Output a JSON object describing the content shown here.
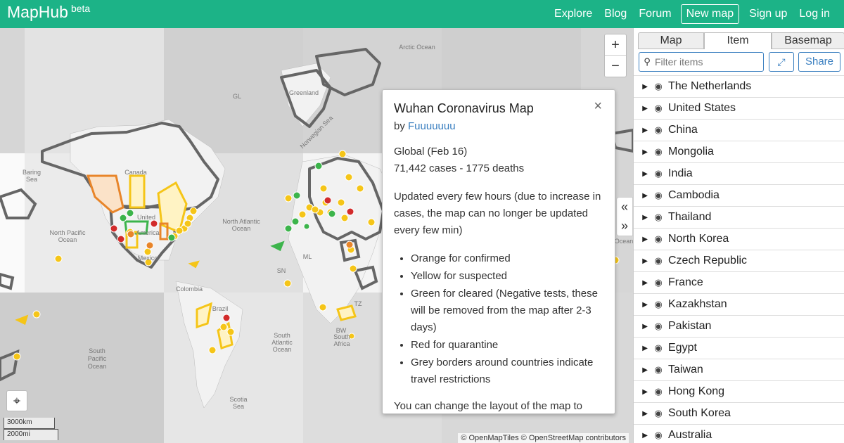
{
  "header": {
    "brand": "MapHub",
    "brand_tag": "beta",
    "nav": [
      "Explore",
      "Blog",
      "Forum",
      "New map",
      "Sign up",
      "Log in"
    ]
  },
  "map": {
    "labels": {
      "arctic": "Arctic Ocean",
      "greenland": "Greenland",
      "gl": "GL",
      "canada": "Canada",
      "united": "United",
      "america": "America",
      "npac1": "North Pacific",
      "npac2": "Ocean",
      "natl1": "North Atlantic",
      "natl2": "Ocean",
      "baring1": "Baring",
      "baring2": "Sea",
      "mexico": "Mexico",
      "colombia": "Colombia",
      "brazil": "Brazil",
      "satl1": "South",
      "satl2": "Atlantic",
      "satl3": "Ocean",
      "spac1": "South",
      "spac2": "Pacific",
      "spac3": "Ocean",
      "scotia1": "Scotia",
      "scotia2": "Sea",
      "norw": "Norwegian Sea",
      "sn": "SN",
      "ml": "ML",
      "tz": "TZ",
      "bw": "BW",
      "safrica1": "South",
      "safrica2": "Africa",
      "ocean_right": "Ocean"
    },
    "zoom_in": "+",
    "zoom_out": "−",
    "scale_km": "3000km",
    "scale_mi": "2000mi",
    "attribution": "© OpenMapTiles © OpenStreetMap contributors"
  },
  "popup": {
    "title": "Wuhan Coronavirus Map",
    "by_prefix": "by",
    "author": "Fuuuuuuu",
    "summary_line1": "Global (Feb 16)",
    "summary_line2": "71,442 cases - 1775 deaths",
    "update_text": "Updated every few hours (due to increase in cases, the map can no longer be updated every few min)",
    "legend": [
      "Orange for confirmed",
      "Yellow for suspected",
      "Green for cleared (Negative tests, these will be removed from the map after 2-3 days)",
      "Red for quarantine",
      "Grey borders around countries indicate travel restrictions"
    ],
    "tail": "You can change the layout of the map to"
  },
  "sidebar": {
    "tabs": [
      "Map",
      "Item",
      "Basemap"
    ],
    "filter_placeholder": "Filter items",
    "share_label": "Share",
    "items": [
      "The Netherlands",
      "United States",
      "China",
      "Mongolia",
      "India",
      "Cambodia",
      "Thailand",
      "North Korea",
      "Czech Republic",
      "France",
      "Kazakhstan",
      "Pakistan",
      "Egypt",
      "Taiwan",
      "Hong Kong",
      "South Korea",
      "Australia"
    ]
  },
  "colors": {
    "brand": "#1cb387",
    "link": "#3a7fc0",
    "confirmed": "#e8852a",
    "suspected": "#f5c518",
    "cleared": "#3cb44b",
    "quarantine": "#d22b2b",
    "restriction": "#666666"
  }
}
